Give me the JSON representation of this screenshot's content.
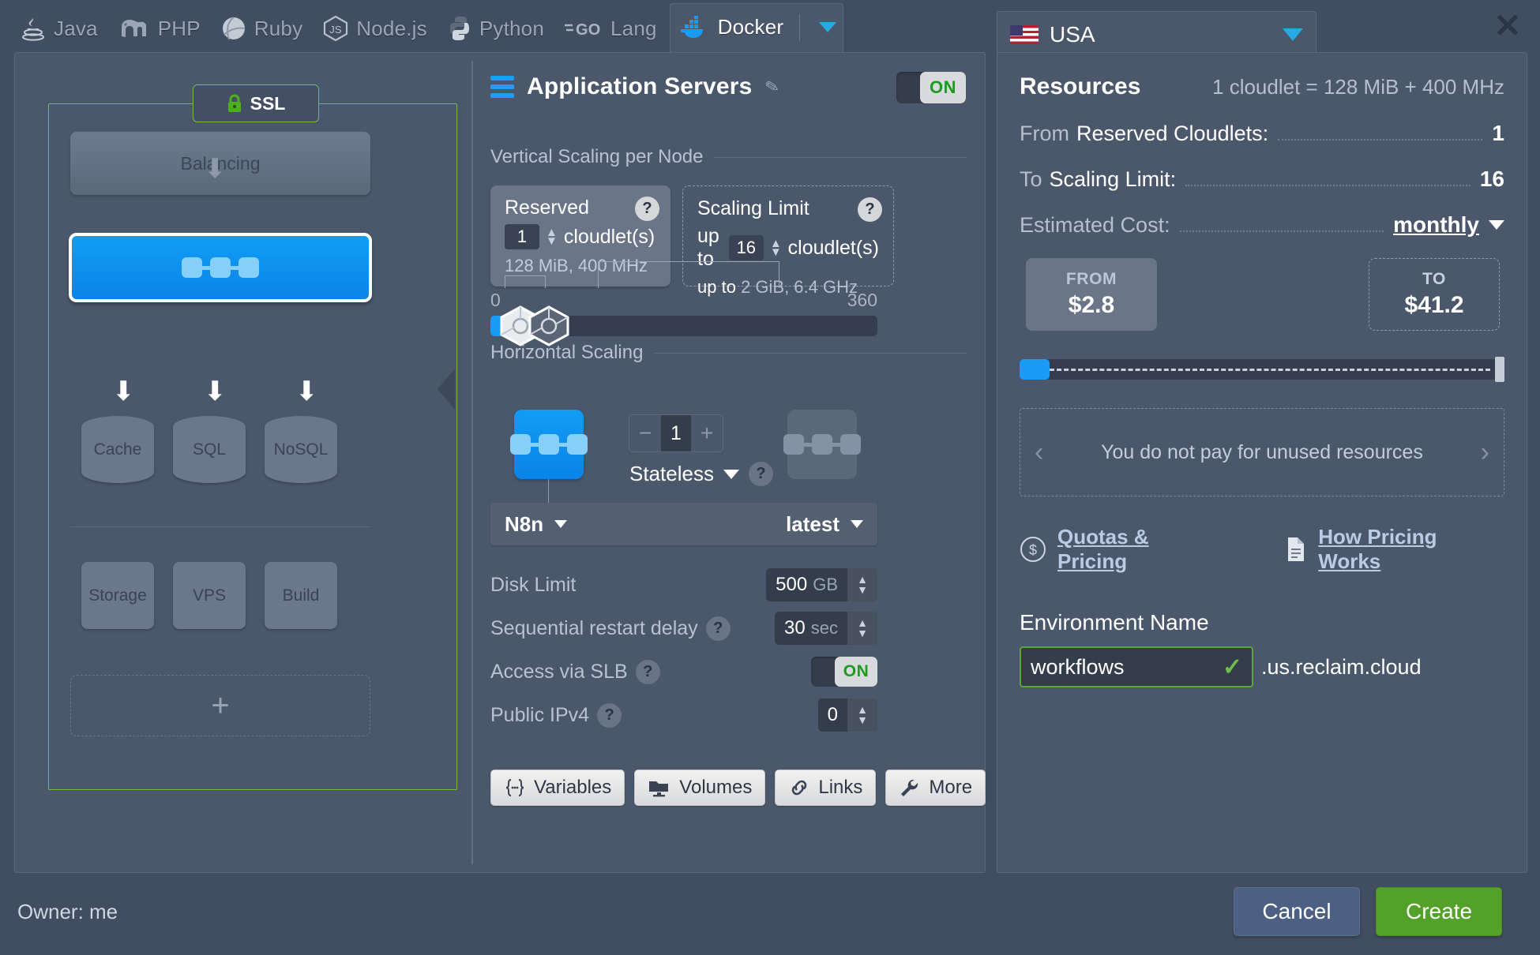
{
  "topbar": {
    "tabs": [
      {
        "label": "Java",
        "icon": "java-icon",
        "active": false
      },
      {
        "label": "PHP",
        "icon": "php-icon",
        "active": false
      },
      {
        "label": "Ruby",
        "icon": "ruby-icon",
        "active": false
      },
      {
        "label": "Node.js",
        "icon": "nodejs-icon",
        "active": false
      },
      {
        "label": "Python",
        "icon": "python-icon",
        "active": false
      },
      {
        "label": "Lang",
        "icon": "go-icon",
        "active": false
      },
      {
        "label": "Docker",
        "icon": "docker-icon",
        "active": true
      }
    ]
  },
  "topology": {
    "ssl_label": "SSL",
    "balancing_label": "Balancing",
    "databases": [
      "Cache",
      "SQL",
      "NoSQL"
    ],
    "extras": [
      "Storage",
      "VPS",
      "Build"
    ],
    "add_label": "+"
  },
  "settings": {
    "title": "Application Servers",
    "toggle_label": "ON",
    "vertical_legend": "Vertical Scaling per Node",
    "reserved": {
      "title": "Reserved",
      "value": "1",
      "unit": "cloudlet(s)",
      "sub": "128 MiB, 400 MHz",
      "help": "?"
    },
    "scaling_limit": {
      "title": "Scaling Limit",
      "prefix": "up to",
      "value": "16",
      "unit": "cloudlet(s)",
      "sub_prefix": "up to",
      "sub": "2 GiB, 6.4 GHz",
      "help": "?"
    },
    "slider": {
      "min": "0",
      "max": "360"
    },
    "horizontal_legend": "Horizontal Scaling",
    "horizontal": {
      "minus": "−",
      "count": "1",
      "plus": "+",
      "mode": "Stateless",
      "help": "?"
    },
    "stack": {
      "name": "N8n",
      "version": "latest"
    },
    "fields": [
      {
        "label": "Disk Limit",
        "help": false,
        "value": "500",
        "unit": "GB",
        "type": "number"
      },
      {
        "label": "Sequential restart delay",
        "help": true,
        "value": "30",
        "unit": "sec",
        "type": "number"
      },
      {
        "label": "Access via SLB",
        "help": true,
        "value": "ON",
        "unit": "",
        "type": "toggle"
      },
      {
        "label": "Public IPv4",
        "help": true,
        "value": "0",
        "unit": "",
        "type": "number"
      }
    ],
    "buttons": [
      {
        "label": "Variables",
        "icon": "variables-icon"
      },
      {
        "label": "Volumes",
        "icon": "volumes-icon"
      },
      {
        "label": "Links",
        "icon": "links-icon"
      },
      {
        "label": "More",
        "icon": "wrench-icon"
      }
    ]
  },
  "sidebar": {
    "country": "USA",
    "close": "✕",
    "resources_title": "Resources",
    "cloudlet_note": "1 cloudlet = 128 MiB + 400 MHz",
    "rows": [
      {
        "k1": "From",
        "k2": "Reserved Cloudlets:",
        "value": "1"
      },
      {
        "k1": "To",
        "k2": "Scaling Limit:",
        "value": "16"
      }
    ],
    "estimated_cost_label": "Estimated Cost:",
    "period": "monthly",
    "cost_from_caption": "FROM",
    "cost_from": "$2.8",
    "cost_to_caption": "TO",
    "cost_to": "$41.2",
    "tip": "You do not pay for unused resources",
    "tip_prev": "‹",
    "tip_next": "›",
    "links": [
      {
        "label": "Quotas & Pricing",
        "icon": "dollar-circle-icon"
      },
      {
        "label": "How Pricing Works",
        "icon": "document-icon"
      }
    ],
    "env_name_label": "Environment Name",
    "env_name_value": "workflows",
    "env_name_valid": "✓",
    "env_domain": ".us.reclaim.cloud"
  },
  "footer": {
    "owner": "Owner: me",
    "cancel": "Cancel",
    "create": "Create"
  },
  "colors": {
    "accent_blue": "#1a9bf5",
    "green": "#53a128",
    "ssl_green": "#6fbf4a",
    "panel": "#4b586c",
    "bg": "#414d60"
  }
}
